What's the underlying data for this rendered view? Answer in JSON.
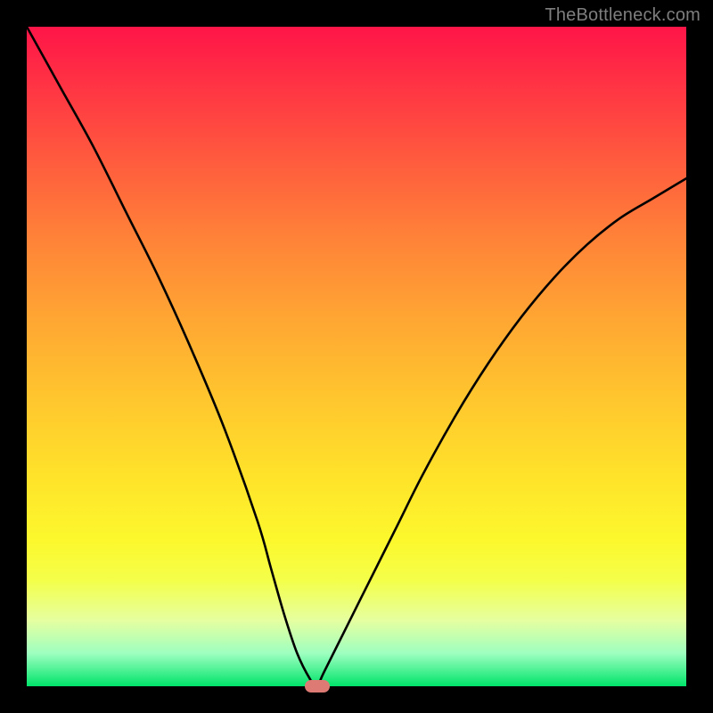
{
  "watermark": "TheBottleneck.com",
  "chart_data": {
    "type": "line",
    "title": "",
    "xlabel": "",
    "ylabel": "",
    "xlim": [
      0,
      100
    ],
    "ylim": [
      0,
      100
    ],
    "grid": false,
    "legend": false,
    "background": "rainbow-vertical-gradient",
    "series": [
      {
        "name": "bottleneck-curve",
        "x": [
          0,
          5,
          10,
          15,
          20,
          25,
          30,
          35,
          37,
          39,
          41,
          43,
          44,
          45,
          48,
          52,
          56,
          60,
          65,
          70,
          75,
          80,
          85,
          90,
          95,
          100
        ],
        "values": [
          100,
          91,
          82,
          72,
          62,
          51,
          39,
          25,
          18,
          11,
          5,
          1,
          0,
          2,
          8,
          16,
          24,
          32,
          41,
          49,
          56,
          62,
          67,
          71,
          74,
          77
        ]
      }
    ],
    "marker": {
      "x": 44,
      "y": 0,
      "color": "#de7a74"
    }
  }
}
